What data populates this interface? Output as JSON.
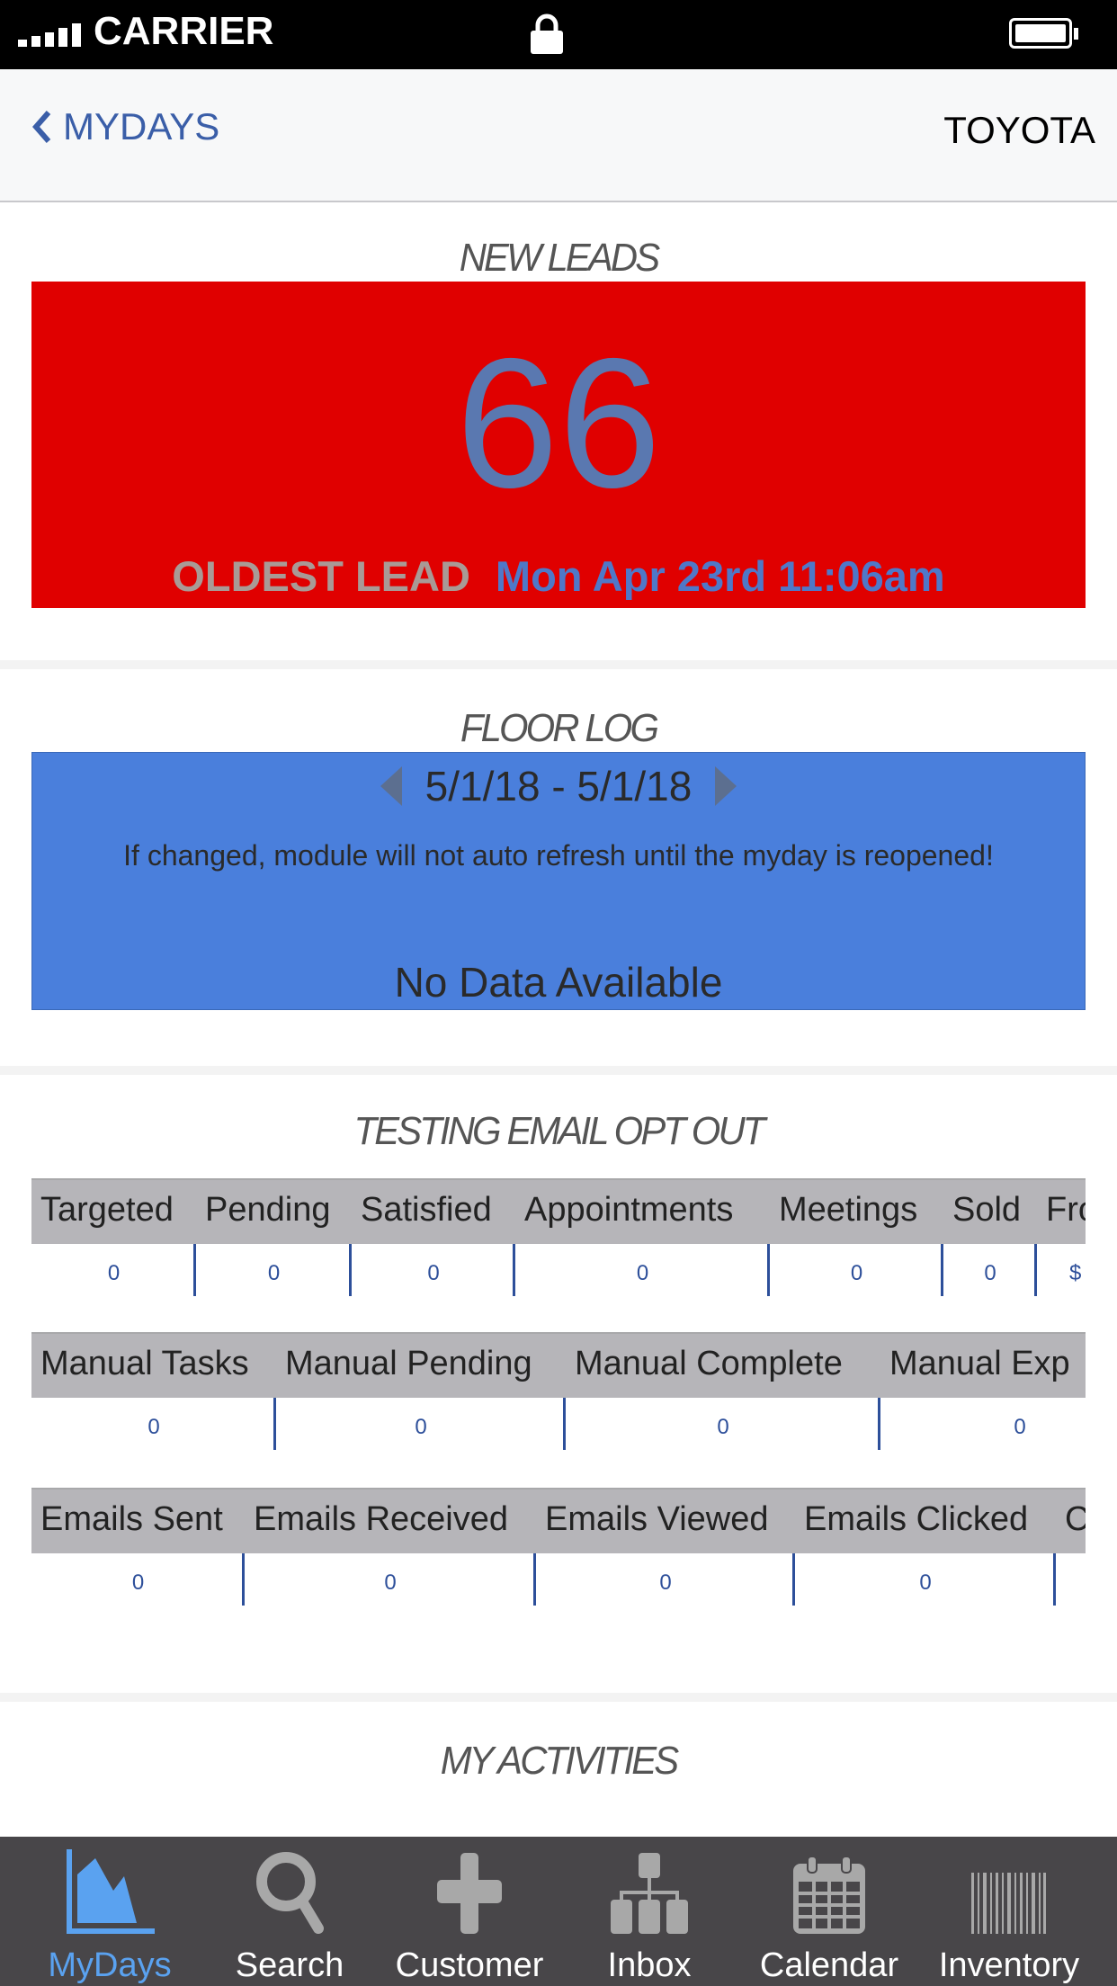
{
  "status_bar": {
    "carrier": "CARRIER",
    "icons": [
      "signal-icon",
      "lock-icon",
      "battery-icon"
    ]
  },
  "nav": {
    "back_label": "MYDAYS",
    "title": "TOYOTA"
  },
  "new_leads": {
    "title": "NEW LEADS",
    "count": "66",
    "oldest_label": "OLDEST LEAD",
    "oldest_date": "Mon Apr 23rd 11:06am",
    "bg_color": "#e00000"
  },
  "floor_log": {
    "title": "FLOOR LOG",
    "date_range": "5/1/18 - 5/1/18",
    "note": "If changed, module will not auto refresh until the myday is reopened!",
    "empty": "No Data Available",
    "bg_color": "#4a7fdc"
  },
  "email_opt_out": {
    "title": "TESTING EMAIL OPT OUT",
    "tables": [
      {
        "columns": [
          {
            "label": "Targeted",
            "value": "0"
          },
          {
            "label": "Pending",
            "value": "0"
          },
          {
            "label": "Satisfied",
            "value": "0"
          },
          {
            "label": "Appointments",
            "value": "0"
          },
          {
            "label": "Meetings",
            "value": "0"
          },
          {
            "label": "Sold",
            "value": "0"
          },
          {
            "label": "Fro",
            "value": "$"
          }
        ]
      },
      {
        "columns": [
          {
            "label": "Manual Tasks",
            "value": "0"
          },
          {
            "label": "Manual Pending",
            "value": "0"
          },
          {
            "label": "Manual Complete",
            "value": "0"
          },
          {
            "label": "Manual Exp",
            "value": "0"
          }
        ]
      },
      {
        "columns": [
          {
            "label": "Emails Sent",
            "value": "0"
          },
          {
            "label": "Emails Received",
            "value": "0"
          },
          {
            "label": "Emails Viewed",
            "value": "0"
          },
          {
            "label": "Emails Clicked",
            "value": "0"
          },
          {
            "label": "C",
            "value": ""
          }
        ]
      }
    ]
  },
  "my_activities": {
    "title": "MY ACTIVITIES"
  },
  "tab_bar": {
    "active": "MyDays",
    "active_color": "#5aa2f0",
    "items": [
      {
        "label": "MyDays",
        "icon": "area-chart-icon"
      },
      {
        "label": "Search",
        "icon": "search-icon"
      },
      {
        "label": "Customer",
        "icon": "plus-icon"
      },
      {
        "label": "Inbox",
        "icon": "org-chart-icon"
      },
      {
        "label": "Calendar",
        "icon": "calendar-icon"
      },
      {
        "label": "Inventory",
        "icon": "barcode-icon"
      }
    ]
  }
}
